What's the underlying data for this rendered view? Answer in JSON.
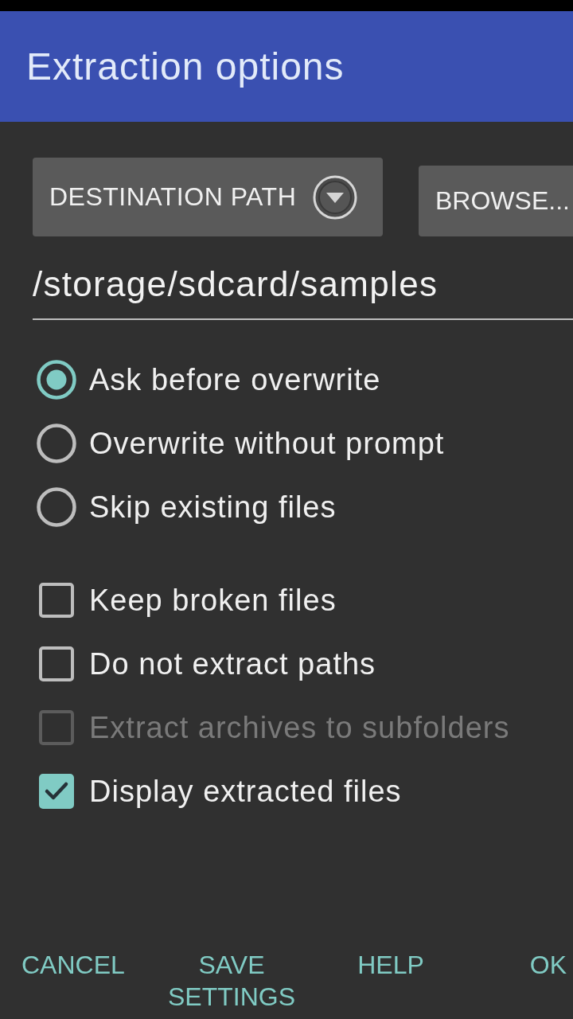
{
  "dialog": {
    "title": "Extraction options"
  },
  "destination": {
    "mode_button": "DESTINATION PATH",
    "browse_button": "BROWSE...",
    "path": "/storage/sdcard/samples"
  },
  "overwrite_options": [
    {
      "label": "Ask before overwrite",
      "selected": true
    },
    {
      "label": "Overwrite without prompt",
      "selected": false
    },
    {
      "label": "Skip existing files",
      "selected": false
    }
  ],
  "checkboxes": [
    {
      "label": "Keep broken files",
      "checked": false,
      "disabled": false
    },
    {
      "label": "Do not extract paths",
      "checked": false,
      "disabled": false
    },
    {
      "label": "Extract archives to subfolders",
      "checked": false,
      "disabled": true
    },
    {
      "label": "Display extracted files",
      "checked": true,
      "disabled": false
    }
  ],
  "buttons": [
    "CANCEL",
    "SAVE SETTINGS",
    "HELP",
    "OK"
  ]
}
